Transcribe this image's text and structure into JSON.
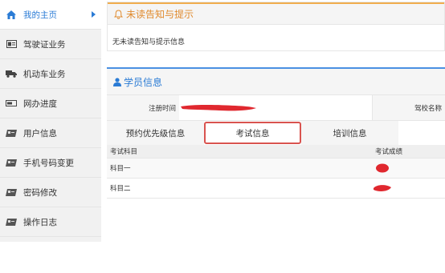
{
  "sidebar": {
    "items": [
      {
        "label": "我的主页",
        "icon": "home-icon"
      },
      {
        "label": "驾驶证业务",
        "icon": "id-card-icon"
      },
      {
        "label": "机动车业务",
        "icon": "truck-icon"
      },
      {
        "label": "网办进度",
        "icon": "progress-icon"
      },
      {
        "label": "用户信息",
        "icon": "user-card-icon"
      },
      {
        "label": "手机号码变更",
        "icon": "phone-icon"
      },
      {
        "label": "密码修改",
        "icon": "key-icon"
      },
      {
        "label": "操作日志",
        "icon": "log-icon"
      }
    ]
  },
  "notice": {
    "title": "未读告知与提示",
    "body": "无未读告知与提示信息",
    "icon": "bell-icon"
  },
  "student": {
    "title": "学员信息",
    "icon": "user-icon",
    "reg_time_label": "注册时间",
    "school_label": "驾校名称",
    "tabs": [
      "预约优先级信息",
      "考试信息",
      "培训信息"
    ],
    "active_tab": "考试信息",
    "table": {
      "headers": [
        "考试科目",
        "考试成绩"
      ],
      "rows": [
        {
          "subject": "科目一"
        },
        {
          "subject": "科目二"
        }
      ]
    }
  },
  "colors": {
    "accent_blue": "#2a7bd5",
    "notice_orange": "#e08a2d",
    "tab_highlight": "#d9534f",
    "redaction_red": "#e0282f"
  }
}
